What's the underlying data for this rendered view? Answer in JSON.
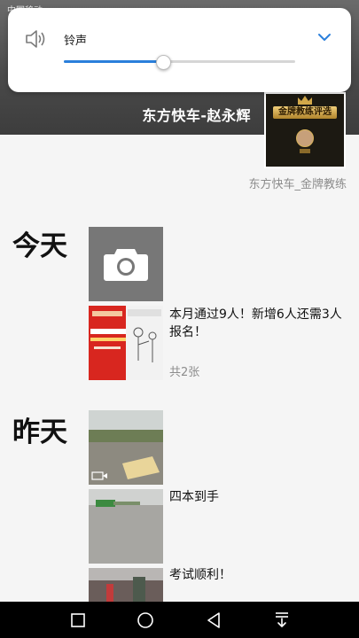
{
  "status_bar": {
    "carrier": "中国移动"
  },
  "profile": {
    "name": "东方快车-赵永辉",
    "subtitle": "东方快车_金牌教练",
    "avatar_badge": "金牌教练评选"
  },
  "feed": {
    "today_label": "今天",
    "yesterday_label": "昨天",
    "posts": [
      {
        "text": "本月通过9人！新增6人还需3人报名！",
        "count": "共2张"
      },
      {
        "text": "四本到手"
      },
      {
        "text": "考试顺利！"
      }
    ]
  },
  "volume_panel": {
    "label": "铃声",
    "level": 0.43,
    "speaker_icon": "speaker-icon",
    "expand_icon": "chevron-down-icon",
    "accent_color": "#2a7fdb"
  },
  "nav_bar": {
    "icons": [
      "recents-square-icon",
      "home-circle-icon",
      "back-triangle-icon",
      "notification-pulldown-icon"
    ]
  }
}
